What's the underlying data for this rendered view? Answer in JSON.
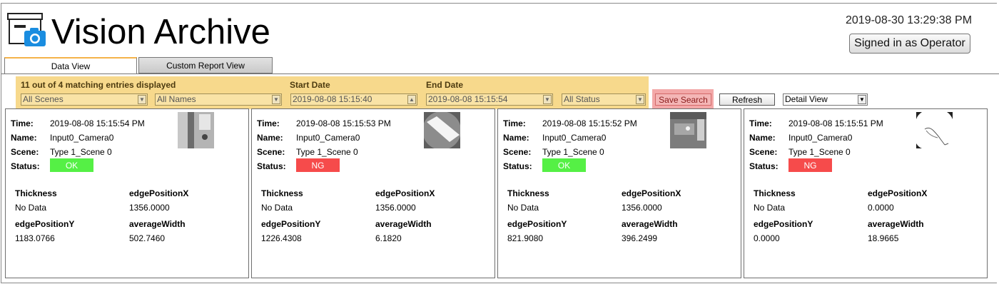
{
  "app": {
    "title": "Vision Archive"
  },
  "header": {
    "datetime": "2019-08-30   13:29:38 PM",
    "signin_label": "Signed in as Operator"
  },
  "tabs": [
    {
      "label": "Data View",
      "active": true
    },
    {
      "label": "Custom Report View",
      "active": false
    }
  ],
  "filters": {
    "summary": "11 out of 4 matching entries displayed",
    "scene": "All Scenes",
    "name": "All Names",
    "start_label": "Start Date",
    "start_value": "2019-08-08 15:15:40",
    "end_label": "End Date",
    "end_value": "2019-08-08 15:15:54",
    "status": "All Status",
    "save_label": "Save Search",
    "refresh_label": "Refresh",
    "view_mode": "Detail View"
  },
  "labels": {
    "time": "Time:",
    "name": "Name:",
    "scene": "Scene:",
    "status": "Status:",
    "thickness": "Thickness",
    "edge_x": "edgePositionX",
    "edge_y": "edgePositionY",
    "avg_width": "averageWidth"
  },
  "colors": {
    "ok": "#55f045",
    "ng": "#f64b4b",
    "filter_bg": "#f7d98c",
    "save_bg": "#f4b6b6"
  },
  "cards": [
    {
      "time": "2019-08-08  15:15:54 PM",
      "name": "Input0_Camera0",
      "scene": "Type 1_Scene 0",
      "status": "OK",
      "thickness": "No Data",
      "edge_x": "1356.0000",
      "edge_y": "1183.0766",
      "avg_width": "502.7460"
    },
    {
      "time": "2019-08-08  15:15:53 PM",
      "name": "Input0_Camera0",
      "scene": "Type 1_Scene 0",
      "status": "NG",
      "thickness": "No Data",
      "edge_x": "1356.0000",
      "edge_y": "1226.4308",
      "avg_width": "6.1820"
    },
    {
      "time": "2019-08-08  15:15:52 PM",
      "name": "Input0_Camera0",
      "scene": "Type 1_Scene 0",
      "status": "OK",
      "thickness": "No Data",
      "edge_x": "1356.0000",
      "edge_y": "821.9080",
      "avg_width": "396.2499"
    },
    {
      "time": "2019-08-08  15:15:51 PM",
      "name": "Input0_Camera0",
      "scene": "Type 1_Scene 0",
      "status": "NG",
      "thickness": "No Data",
      "edge_x": "0.0000",
      "edge_y": "0.0000",
      "avg_width": "18.9665"
    }
  ]
}
